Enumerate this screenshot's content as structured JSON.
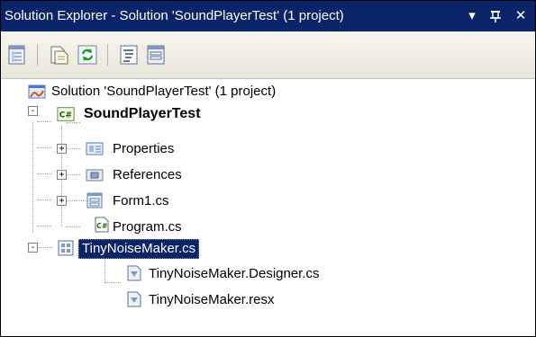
{
  "window": {
    "title": "Solution Explorer - Solution 'SoundPlayerTest' (1 project)",
    "controls": {
      "dropdown_icon": "▾",
      "pin_icon": "Θ",
      "close_icon": "✕"
    }
  },
  "toolbar": {
    "buttons": [
      {
        "name": "properties-button"
      },
      {
        "name": "show-all-files-button"
      },
      {
        "name": "refresh-button"
      },
      {
        "name": "view-code-button"
      },
      {
        "name": "view-designer-button"
      }
    ]
  },
  "tree": {
    "solution": {
      "label": "Solution 'SoundPlayerTest' (1 project)"
    },
    "project": {
      "label": "SoundPlayerTest",
      "expander": "-"
    },
    "items": [
      {
        "label": "Properties",
        "expander": "+"
      },
      {
        "label": "References",
        "expander": "+"
      },
      {
        "label": "Form1.cs",
        "expander": "+"
      },
      {
        "label": "Program.cs"
      },
      {
        "label": "TinyNoiseMaker.cs",
        "expander": "-",
        "selected": true
      }
    ],
    "children": [
      {
        "label": "TinyNoiseMaker.Designer.cs"
      },
      {
        "label": "TinyNoiseMaker.resx"
      }
    ]
  },
  "colors": {
    "title_bg": "#0a246a",
    "selection_bg": "#0a246a"
  }
}
